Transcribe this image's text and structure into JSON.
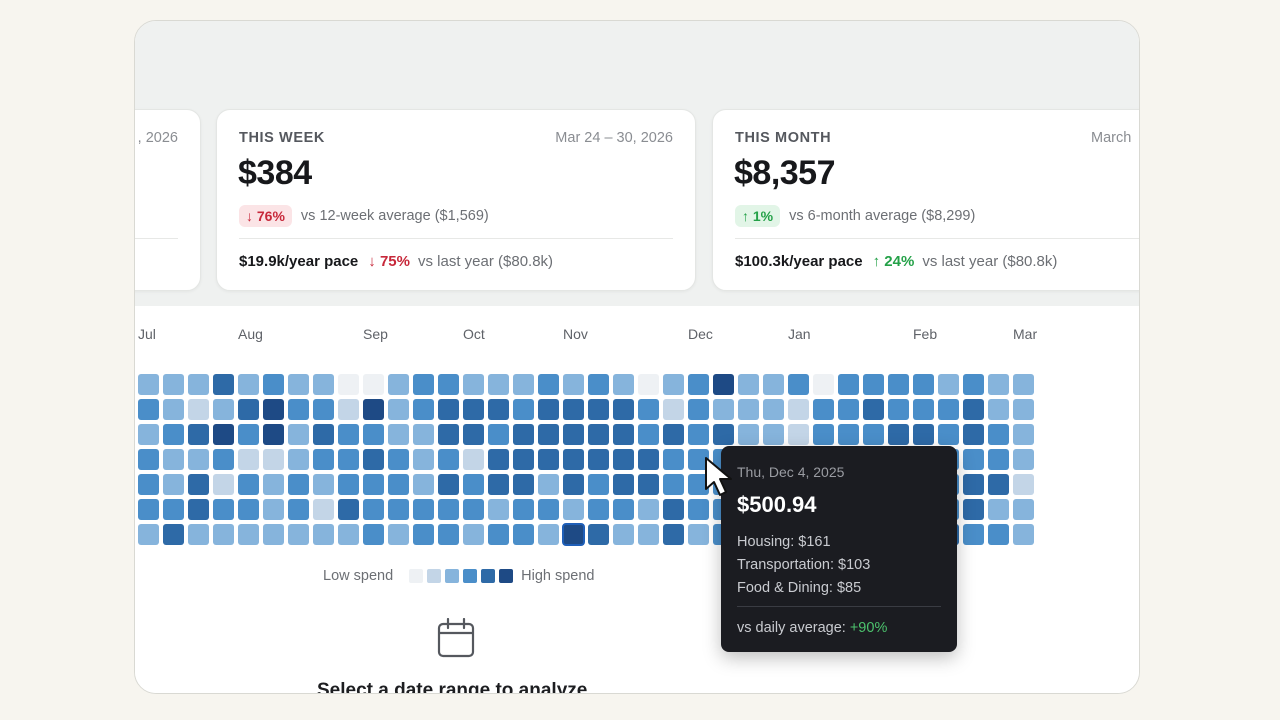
{
  "cards": {
    "prev": {
      "range": ", 2026"
    },
    "week": {
      "label": "THIS WEEK",
      "range": "Mar 24 – 30, 2026",
      "amount": "$384",
      "change_pill": "↓ 76%",
      "change_note": "vs 12-week average ($1,569)",
      "pace_value": "$19.9k/year pace",
      "pace_change": "↓ 75%",
      "pace_note": "vs last year ($80.8k)"
    },
    "month": {
      "label": "THIS MONTH",
      "range": "March",
      "amount": "$8,357",
      "change_pill": "↑ 1%",
      "change_note": "vs 6-month average ($8,299)",
      "pace_value": "$100.3k/year pace",
      "pace_change": "↑ 24%",
      "pace_note": "vs last year ($80.8k)"
    }
  },
  "heatmap": {
    "months": [
      "Jul",
      "Aug",
      "Sep",
      "Oct",
      "Nov",
      "Dec",
      "Jan",
      "Feb",
      "Mar"
    ],
    "month_week_index": [
      0,
      4,
      9,
      13,
      17,
      22,
      26,
      31,
      35
    ],
    "palette": [
      "#eef1f4",
      "#c3d5e7",
      "#86b4dc",
      "#4a8ec9",
      "#2e6aa7",
      "#1e4a85"
    ],
    "selected_cell": {
      "week": 17,
      "day": 6
    },
    "levels": [
      [
        2,
        2,
        2,
        4,
        2,
        3,
        2,
        2,
        0,
        0,
        2,
        3,
        3,
        2,
        2,
        2,
        3,
        2,
        3,
        2,
        0,
        2,
        3,
        5,
        2,
        2,
        3,
        0,
        3,
        3,
        3,
        3,
        2,
        3,
        2,
        2
      ],
      [
        3,
        2,
        1,
        2,
        4,
        5,
        3,
        3,
        1,
        5,
        2,
        3,
        4,
        4,
        4,
        3,
        4,
        4,
        4,
        4,
        3,
        1,
        3,
        2,
        2,
        2,
        1,
        3,
        3,
        4,
        3,
        3,
        3,
        4,
        2,
        2
      ],
      [
        2,
        3,
        4,
        5,
        3,
        5,
        2,
        4,
        3,
        3,
        2,
        2,
        4,
        4,
        3,
        4,
        4,
        4,
        4,
        4,
        3,
        4,
        3,
        4,
        2,
        2,
        1,
        3,
        3,
        3,
        4,
        4,
        3,
        4,
        3,
        2
      ],
      [
        3,
        2,
        2,
        3,
        1,
        1,
        2,
        3,
        3,
        4,
        3,
        2,
        3,
        1,
        4,
        4,
        4,
        4,
        4,
        4,
        4,
        3,
        3,
        3,
        3,
        4,
        2,
        1,
        1,
        2,
        3,
        4,
        3,
        3,
        3,
        2
      ],
      [
        3,
        2,
        4,
        1,
        3,
        2,
        3,
        2,
        3,
        3,
        3,
        2,
        4,
        3,
        4,
        4,
        2,
        4,
        3,
        4,
        4,
        3,
        3,
        3,
        4,
        3,
        3,
        2,
        3,
        3,
        2,
        4,
        3,
        4,
        4,
        1
      ],
      [
        3,
        3,
        4,
        3,
        3,
        2,
        3,
        1,
        4,
        3,
        3,
        3,
        3,
        3,
        2,
        3,
        3,
        2,
        3,
        3,
        2,
        4,
        3,
        3,
        4,
        3,
        3,
        3,
        4,
        4,
        2,
        2,
        3,
        4,
        2,
        2
      ],
      [
        2,
        4,
        2,
        2,
        2,
        2,
        2,
        2,
        2,
        3,
        2,
        3,
        3,
        2,
        3,
        3,
        2,
        5,
        4,
        2,
        2,
        4,
        2,
        3,
        2,
        2,
        3,
        2,
        2,
        2,
        3,
        2,
        4,
        3,
        3,
        2
      ]
    ]
  },
  "legend": {
    "low": "Low spend",
    "high": "High spend",
    "swatches": [
      "#eef1f4",
      "#c3d5e7",
      "#86b4dc",
      "#4a8ec9",
      "#2e6aa7",
      "#1e4a85"
    ]
  },
  "empty_state": {
    "title": "Select a date range to analyze",
    "icon": "calendar-icon"
  },
  "tooltip": {
    "date": "Thu, Dec 4, 2025",
    "amount": "$500.94",
    "rows": [
      "Housing: $161",
      "Transportation: $103",
      "Food & Dining: $85"
    ],
    "footer_label": "vs daily average:",
    "footer_value": "+90%"
  },
  "colors": {
    "negative": "#c7283a",
    "positive": "#24a148",
    "accent": "#1f5fb8"
  }
}
